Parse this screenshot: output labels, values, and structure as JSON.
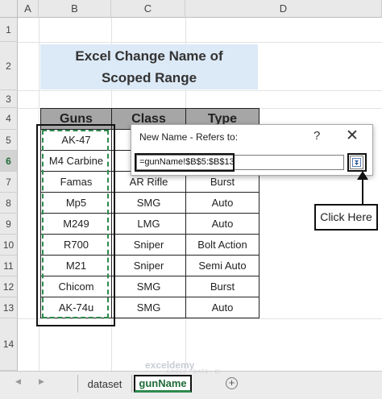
{
  "columns": [
    "A",
    "B",
    "C",
    "D"
  ],
  "rows": [
    "1",
    "2",
    "3",
    "4",
    "5",
    "6",
    "7",
    "8",
    "9",
    "10",
    "11",
    "12",
    "13",
    "14"
  ],
  "title": {
    "line1": "Excel Change Name of",
    "line2": "Scoped Range"
  },
  "table": {
    "headers": [
      "Guns",
      "Class",
      "Type"
    ],
    "rows": [
      [
        "AK-47",
        "",
        ""
      ],
      [
        "M4 Carbine",
        "",
        ""
      ],
      [
        "Famas",
        "AR Rifle",
        "Burst"
      ],
      [
        "Mp5",
        "SMG",
        "Auto"
      ],
      [
        "M249",
        "LMG",
        "Auto"
      ],
      [
        "R700",
        "Sniper",
        "Bolt Action"
      ],
      [
        "M21",
        "Sniper",
        "Semi Auto"
      ],
      [
        "Chicom",
        "SMG",
        "Burst"
      ],
      [
        "AK-74u",
        "SMG",
        "Auto"
      ]
    ]
  },
  "dialog": {
    "title": "New Name - Refers to:",
    "help": "?",
    "close": "✕",
    "value": "=gunName!$B$5:$B$13"
  },
  "callout": "Click Here",
  "sheets": [
    {
      "name": "dataset",
      "active": false
    },
    {
      "name": "gunName",
      "active": true
    }
  ],
  "add_sheet": "+",
  "nav": {
    "prev": "◀",
    "next": "▶"
  },
  "watermark": {
    "brand": "exceldemy",
    "sub": "EXCEL · DATA · BI"
  },
  "colors": {
    "accent": "#2f8a4e",
    "title_bg": "#dce9f6",
    "header_bg": "#a6a6a6"
  }
}
